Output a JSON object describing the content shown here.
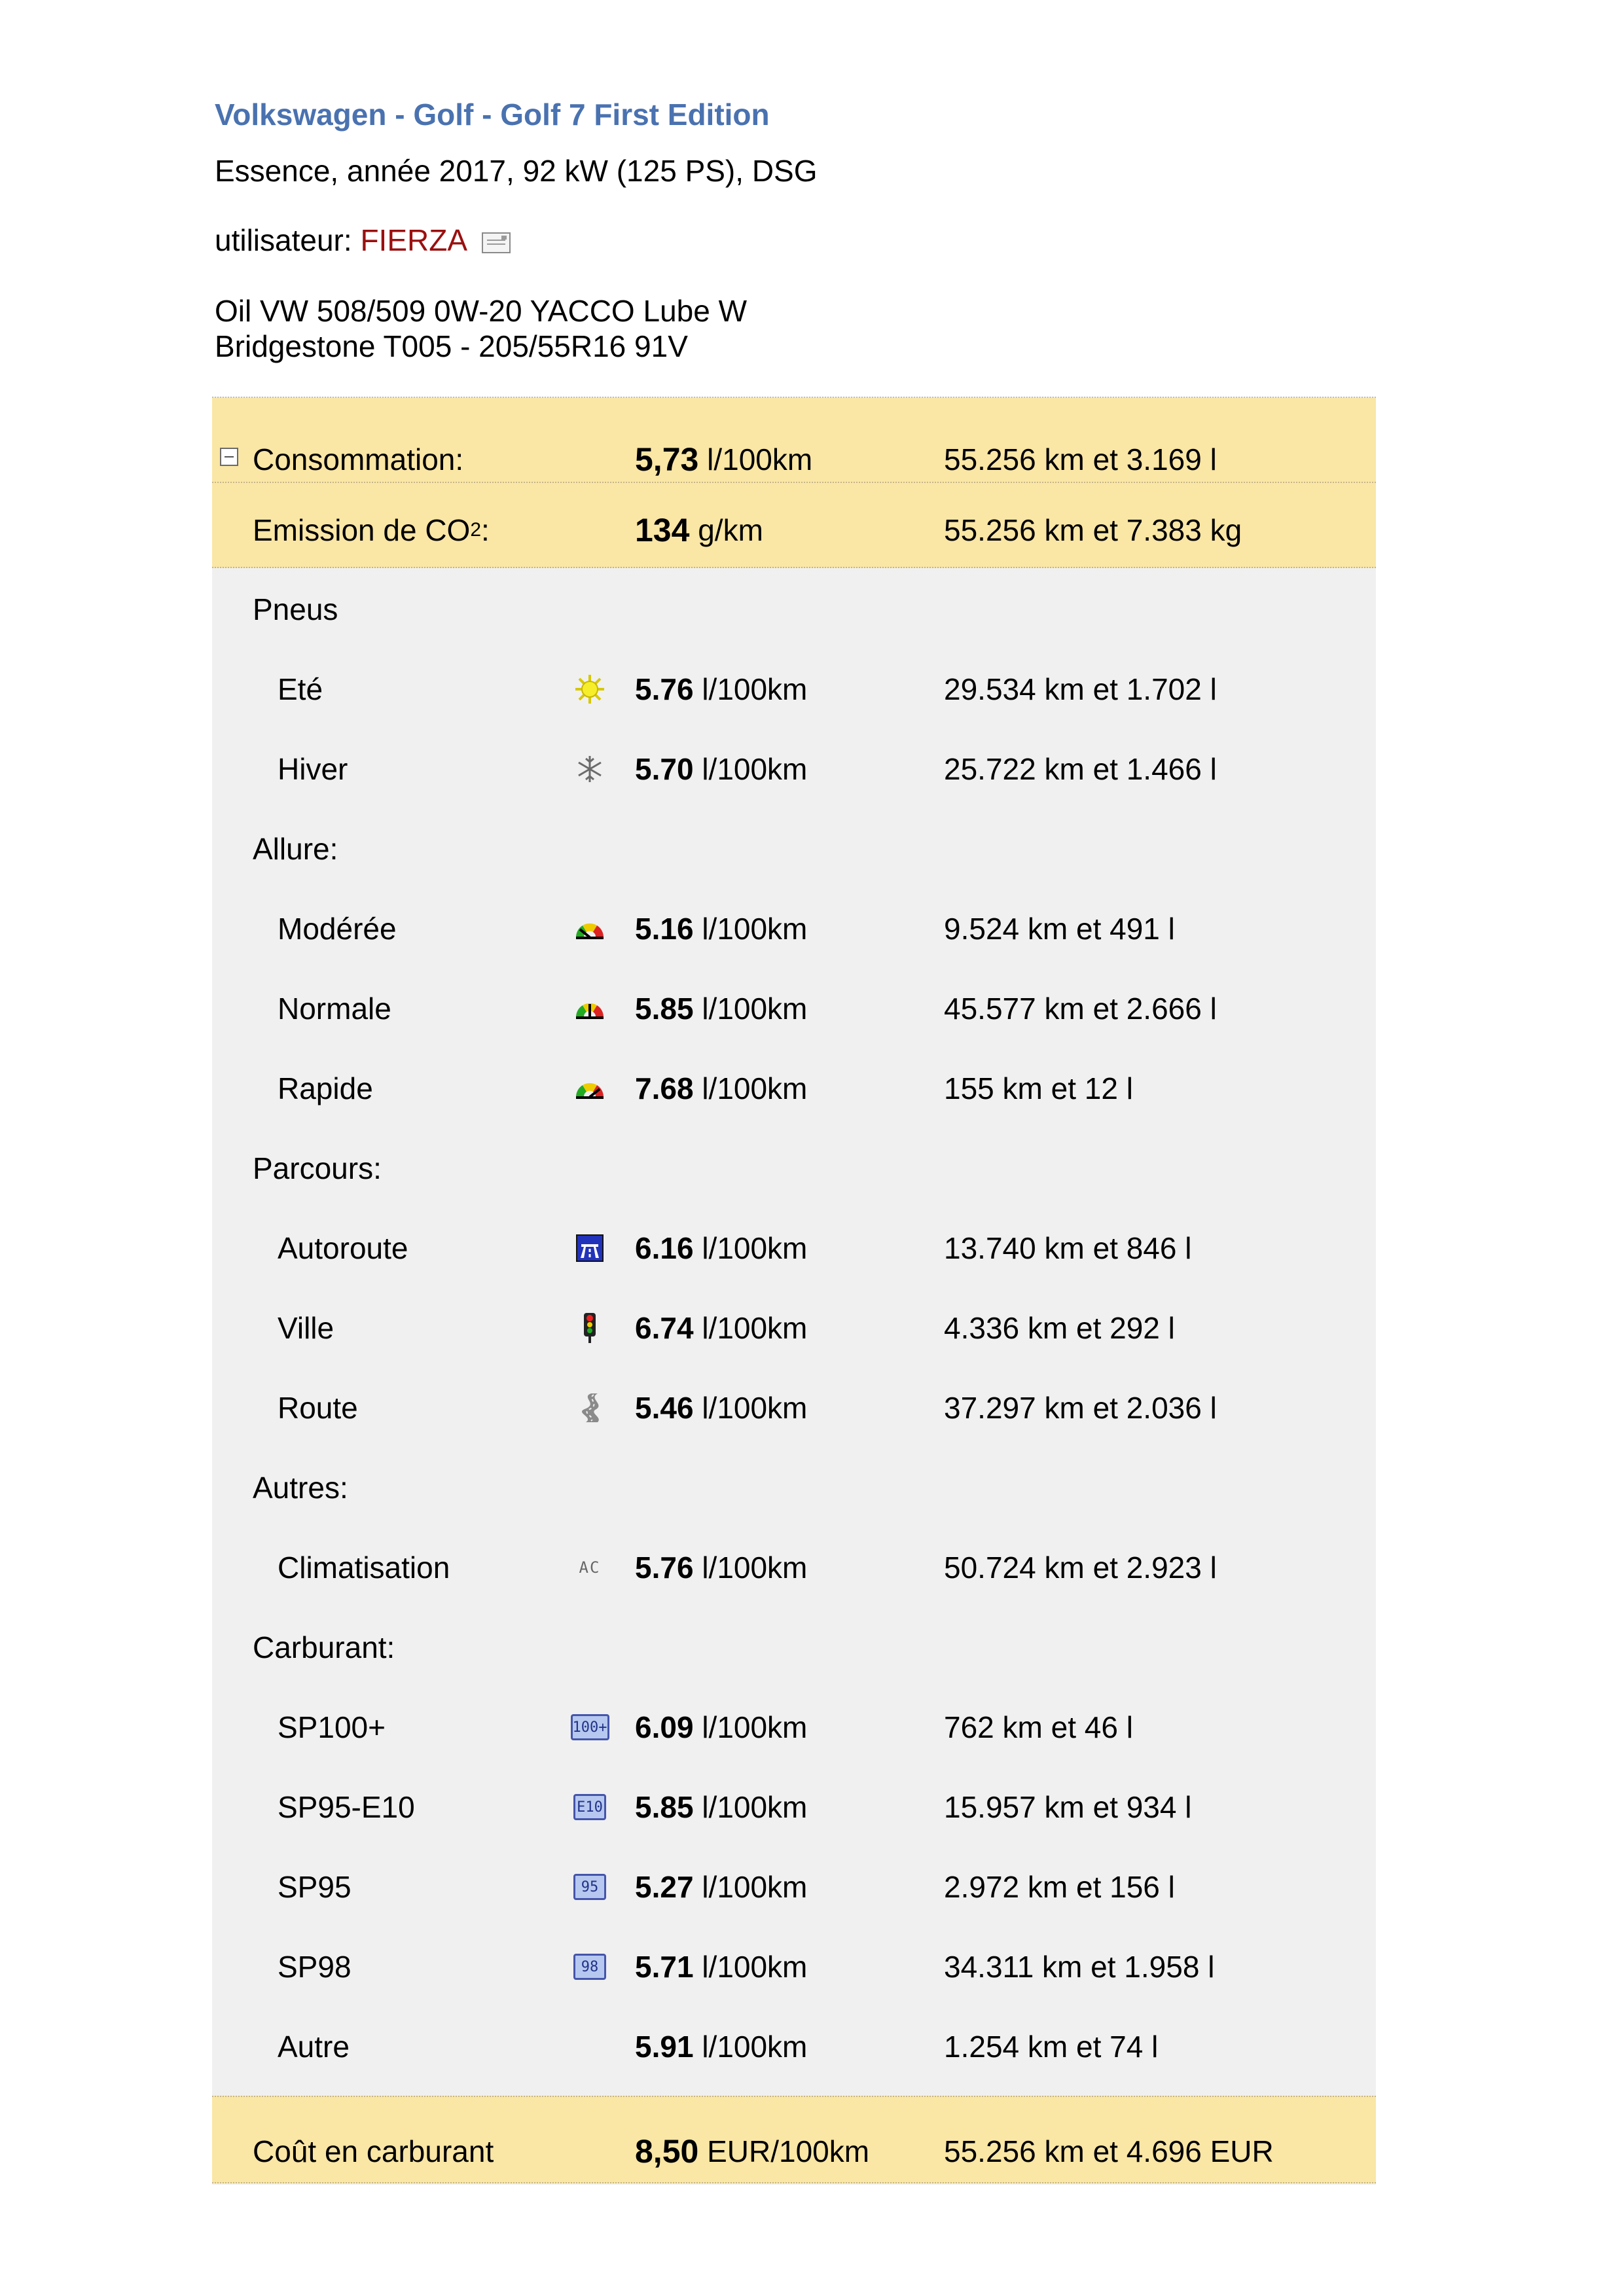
{
  "header": {
    "title": "Volkswagen - Golf - Golf 7 First Edition",
    "subtitle": "Essence, année 2017, 92 kW (125 PS), DSG",
    "user_label": "utilisateur:",
    "user_name": "FIERZA",
    "notes": [
      "Oil VW 508/509 0W-20 YACCO Lube W",
      "Bridgestone T005 - 205/55R16 91V"
    ]
  },
  "consumption": {
    "label": "Consommation:",
    "value": "5,73",
    "unit": "l/100km",
    "total": "55.256 km et 3.169 l"
  },
  "co2": {
    "label_main": "Emission de CO",
    "label_sub": "2",
    "label_end": ":",
    "value": "134",
    "unit": "g/km",
    "total": "55.256 km et 7.383 kg"
  },
  "sections": [
    {
      "title": "Pneus",
      "items": [
        {
          "label": "Eté",
          "icon": "sun-icon",
          "value": "5.76",
          "unit": "l/100km",
          "total": "29.534 km et 1.702 l"
        },
        {
          "label": "Hiver",
          "icon": "snowflake-icon",
          "value": "5.70",
          "unit": "l/100km",
          "total": "25.722 km et 1.466 l"
        }
      ]
    },
    {
      "title": "Allure:",
      "items": [
        {
          "label": "Modérée",
          "icon": "gauge-low-icon",
          "value": "5.16",
          "unit": "l/100km",
          "total": "9.524 km et 491 l"
        },
        {
          "label": "Normale",
          "icon": "gauge-mid-icon",
          "value": "5.85",
          "unit": "l/100km",
          "total": "45.577 km et 2.666 l"
        },
        {
          "label": "Rapide",
          "icon": "gauge-high-icon",
          "value": "7.68",
          "unit": "l/100km",
          "total": "155 km et 12 l"
        }
      ]
    },
    {
      "title": "Parcours:",
      "items": [
        {
          "label": "Autoroute",
          "icon": "highway-icon",
          "value": "6.16",
          "unit": "l/100km",
          "total": "13.740 km et 846 l"
        },
        {
          "label": "Ville",
          "icon": "traffic-light-icon",
          "value": "6.74",
          "unit": "l/100km",
          "total": "4.336 km et 292 l"
        },
        {
          "label": "Route",
          "icon": "winding-road-icon",
          "value": "5.46",
          "unit": "l/100km",
          "total": "37.297 km et 2.036 l"
        }
      ]
    },
    {
      "title": "Autres:",
      "items": [
        {
          "label": "Climatisation",
          "icon": "ac-icon",
          "icon_text": "AC",
          "value": "5.76",
          "unit": "l/100km",
          "total": "50.724 km et 2.923 l"
        }
      ]
    },
    {
      "title": "Carburant:",
      "items": [
        {
          "label": "SP100+",
          "icon": "fuel-sp100-icon",
          "icon_text": "100+",
          "value": "6.09",
          "unit": "l/100km",
          "total": "762 km et 46 l"
        },
        {
          "label": "SP95-E10",
          "icon": "fuel-e10-icon",
          "icon_text": "E10",
          "value": "5.85",
          "unit": "l/100km",
          "total": "15.957 km et 934 l"
        },
        {
          "label": "SP95",
          "icon": "fuel-95-icon",
          "icon_text": "95",
          "value": "5.27",
          "unit": "l/100km",
          "total": "2.972 km et 156 l"
        },
        {
          "label": "SP98",
          "icon": "fuel-98-icon",
          "icon_text": "98",
          "value": "5.71",
          "unit": "l/100km",
          "total": "34.311 km et 1.958 l"
        },
        {
          "label": "Autre",
          "icon": "",
          "value": "5.91",
          "unit": "l/100km",
          "total": "1.254 km et 74 l"
        }
      ]
    }
  ],
  "fuel_cost": {
    "label": "Coût en carburant",
    "value": "8,50",
    "unit": "EUR/100km",
    "total": "55.256 km et 4.696 EUR"
  },
  "colors": {
    "title": "#4a72b0",
    "user_name": "#9a1010",
    "summary_bg": "#fae6a5",
    "panel_bg": "#f0f0f0"
  }
}
